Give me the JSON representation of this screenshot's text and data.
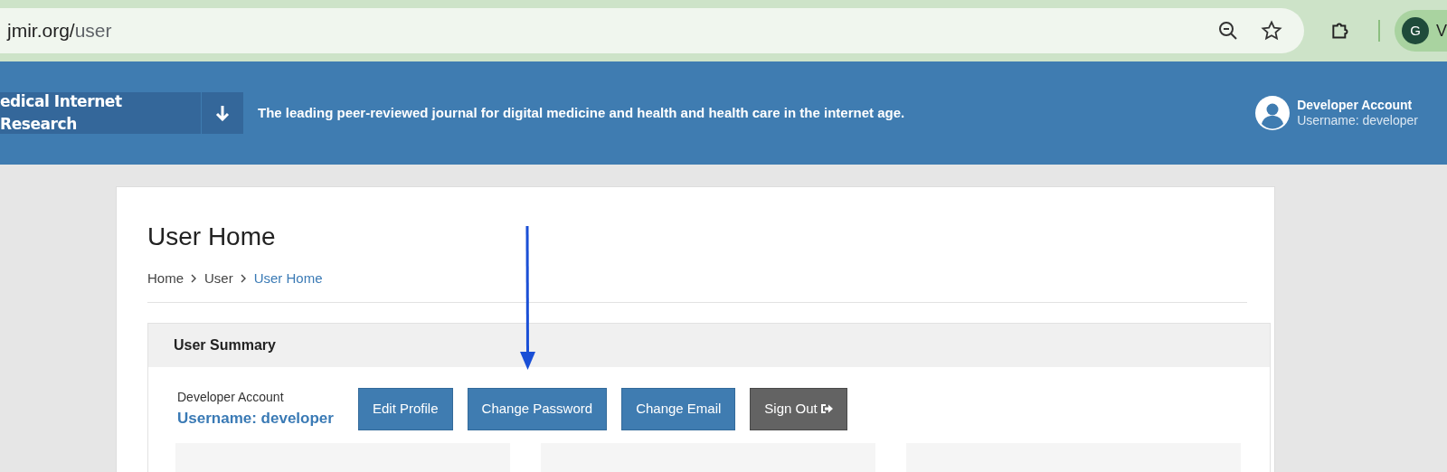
{
  "browser": {
    "url_host": "jmir.org/",
    "url_path": "user",
    "profile_initial": "G",
    "profile_name": "V"
  },
  "header": {
    "journal_title": "edical Internet Research",
    "tagline": "The leading peer-reviewed journal for digital medicine and health and health care in the internet age.",
    "account_name": "Developer Account",
    "account_username": "Username: developer"
  },
  "page": {
    "title": "User Home",
    "breadcrumb": [
      {
        "label": "Home",
        "current": false
      },
      {
        "label": "User",
        "current": false
      },
      {
        "label": "User Home",
        "current": true
      }
    ]
  },
  "summary": {
    "title": "User Summary",
    "account_name": "Developer Account",
    "username": "Username: developer",
    "buttons": [
      {
        "label": "Edit Profile",
        "kind": "primary"
      },
      {
        "label": "Change Password",
        "kind": "primary"
      },
      {
        "label": "Change Email",
        "kind": "primary"
      },
      {
        "label": "Sign Out",
        "kind": "signout"
      }
    ]
  }
}
